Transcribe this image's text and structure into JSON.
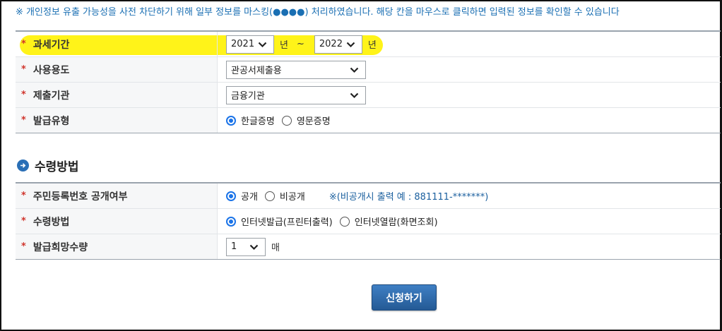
{
  "notice": "※ 개인정보 유출 가능성을 사전 차단하기 위해 일부 정보를 마스킹(●●●●) 처리하였습니다. 해당 칸을 마우스로 클릭하면 입력된 정보를 확인할 수 있습니다",
  "required_mark": "*",
  "colors": {
    "highlight": "#fff200",
    "required": "#d0342c",
    "accent": "#1a73e8",
    "button": "#2f6aaa"
  },
  "form": {
    "tax_period": {
      "label": "과세기간",
      "from_year": "2021",
      "year_unit": "년",
      "tilde": "~",
      "to_year": "2022"
    },
    "purpose": {
      "label": "사용용도",
      "value": "관공서제출용"
    },
    "submit_to": {
      "label": "제출기관",
      "value": "금융기관"
    },
    "issue_type": {
      "label": "발급유형",
      "options": [
        {
          "label": "한글증명",
          "selected": true
        },
        {
          "label": "영문증명",
          "selected": false
        }
      ]
    }
  },
  "receive_section": {
    "title": "수령방법",
    "icon": "arrow-right-circle-icon",
    "id_disclosure": {
      "label": "주민등록번호 공개여부",
      "options": [
        {
          "label": "공개",
          "selected": true
        },
        {
          "label": "비공개",
          "selected": false
        }
      ],
      "hint": "※(비공개시 출력 예 : 881111-*******)"
    },
    "method": {
      "label": "수령방법",
      "options": [
        {
          "label": "인터넷발급(프린터출력)",
          "selected": true
        },
        {
          "label": "인터넷열람(화면조회)",
          "selected": false
        }
      ]
    },
    "quantity": {
      "label": "발급희망수량",
      "value": "1",
      "unit": "매"
    }
  },
  "submit_label": "신청하기"
}
